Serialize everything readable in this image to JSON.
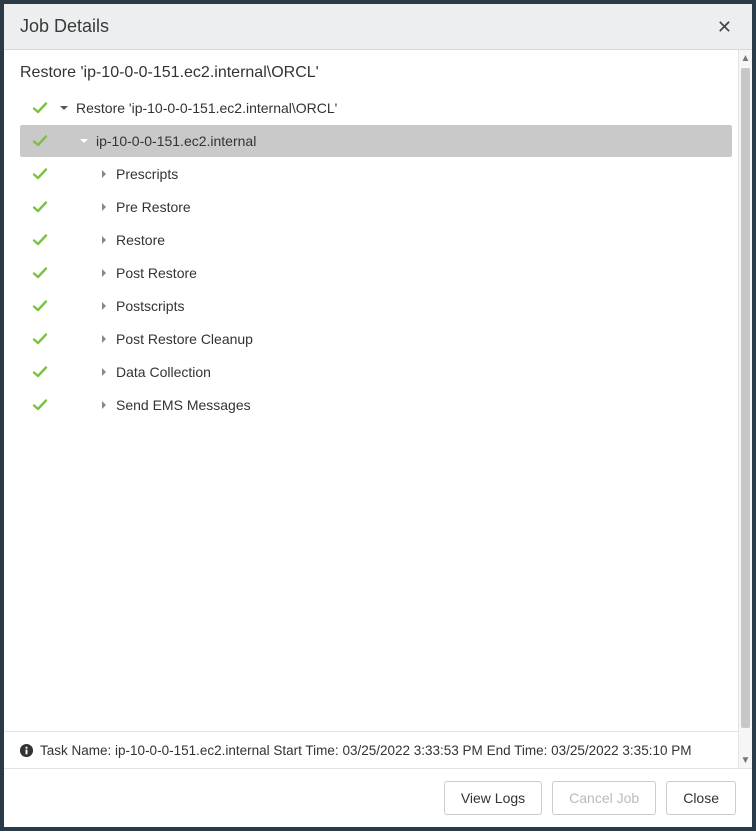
{
  "title": "Job Details",
  "subtitle": "Restore 'ip-10-0-0-151.ec2.internal\\ORCL'",
  "tree": {
    "root": {
      "label": "Restore 'ip-10-0-0-151.ec2.internal\\ORCL'",
      "status": "success",
      "expanded": true
    },
    "node": {
      "label": "ip-10-0-0-151.ec2.internal",
      "status": "success",
      "expanded": true,
      "selected": true
    },
    "children": [
      {
        "label": "Prescripts",
        "status": "success"
      },
      {
        "label": "Pre Restore",
        "status": "success"
      },
      {
        "label": "Restore",
        "status": "success"
      },
      {
        "label": "Post Restore",
        "status": "success"
      },
      {
        "label": "Postscripts",
        "status": "success"
      },
      {
        "label": "Post Restore Cleanup",
        "status": "success"
      },
      {
        "label": "Data Collection",
        "status": "success"
      },
      {
        "label": "Send EMS Messages",
        "status": "success"
      }
    ]
  },
  "info": {
    "task_name_label": "Task Name:",
    "task_name": "ip-10-0-0-151.ec2.internal",
    "start_label": "Start Time:",
    "start_time": "03/25/2022 3:33:53 PM",
    "end_label": "End Time:",
    "end_time": "03/25/2022 3:35:10 PM"
  },
  "buttons": {
    "view_logs": "View Logs",
    "cancel_job": "Cancel Job",
    "close": "Close"
  }
}
